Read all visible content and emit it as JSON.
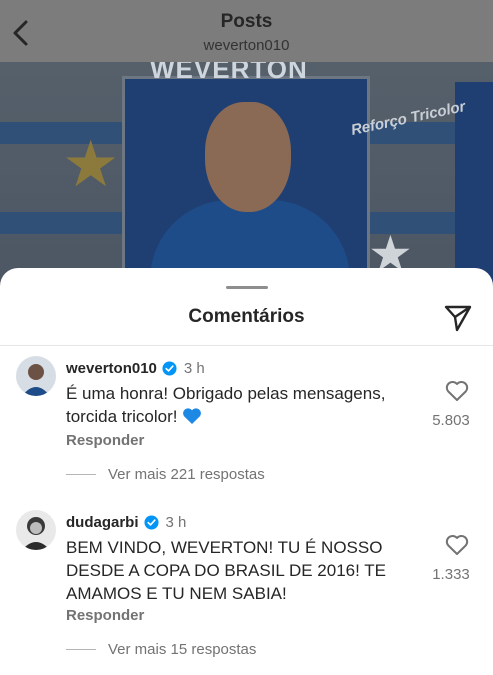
{
  "header": {
    "title": "Posts",
    "username": "weverton010"
  },
  "post_image": {
    "banner_text": "WEVERTON",
    "tag_text": "Reforço Tricolor"
  },
  "sheet": {
    "title": "Comentários"
  },
  "comments": [
    {
      "username": "weverton010",
      "time": "3 h",
      "text": "É uma honra! Obrigado pelas mensagens, torcida tricolor!",
      "emoji": "blue-heart-emoji",
      "likes": "5.803",
      "reply_label": "Responder",
      "more_replies": "Ver mais 221 respostas"
    },
    {
      "username": "dudagarbi",
      "time": "3 h",
      "text": "BEM VINDO, WEVERTON! TU É NOSSO DESDE A COPA DO BRASIL DE 2016! TE AMAMOS E TU NEM SABIA!",
      "likes": "1.333",
      "reply_label": "Responder",
      "more_replies": "Ver mais 15 respostas"
    }
  ],
  "colors": {
    "verified": "#0095f6",
    "heart_emoji": "#1e88e5",
    "muted_text": "#737373"
  }
}
